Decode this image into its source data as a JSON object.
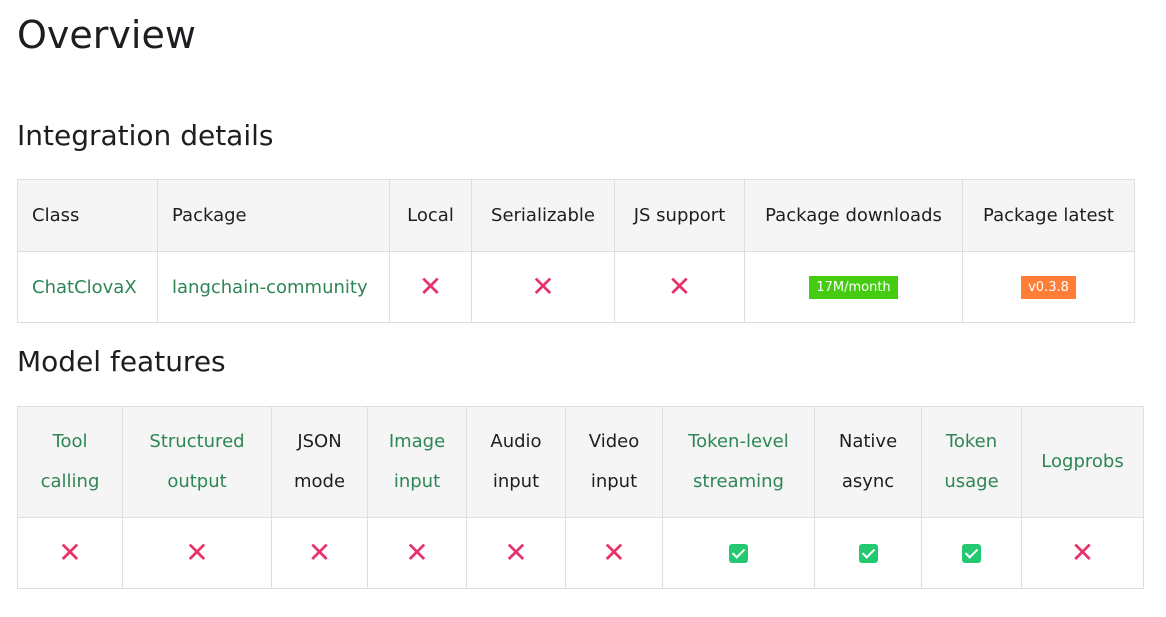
{
  "page": {
    "title": "Overview"
  },
  "integration_details": {
    "heading": "Integration details",
    "headers": [
      "Class",
      "Package",
      "Local",
      "Serializable",
      "JS support",
      "Package downloads",
      "Package latest"
    ],
    "row": {
      "class": "ChatClovaX",
      "package": "langchain-community",
      "local_icon": "cross-icon",
      "serializable_icon": "cross-icon",
      "js_support_icon": "cross-icon",
      "downloads_badge": "17M/month",
      "latest_badge": "v0.3.8"
    }
  },
  "model_features": {
    "heading": "Model features",
    "headers": [
      {
        "line1": "Tool",
        "line2": "calling"
      },
      {
        "line1": "Structured",
        "line2": "output"
      },
      {
        "line1": "JSON",
        "line2": "mode"
      },
      {
        "line1": "Image",
        "line2": "input"
      },
      {
        "line1": "Audio",
        "line2": "input"
      },
      {
        "line1": "Video",
        "line2": "input"
      },
      {
        "line1": "Token-level",
        "line2": "streaming"
      },
      {
        "line1": "Native",
        "line2": "async"
      },
      {
        "line1": "Token",
        "line2": "usage"
      },
      {
        "line1": "Logprobs",
        "line2": ""
      }
    ],
    "values": [
      "cross-icon",
      "cross-icon",
      "cross-icon",
      "cross-icon",
      "cross-icon",
      "cross-icon",
      "check-icon",
      "check-icon",
      "check-icon",
      "cross-icon"
    ]
  },
  "colors": {
    "link": "#2e8555",
    "cross": "#e8326a",
    "check": "#24c870",
    "badge_downloads": "#44cc11",
    "badge_latest": "#fe7d37"
  }
}
